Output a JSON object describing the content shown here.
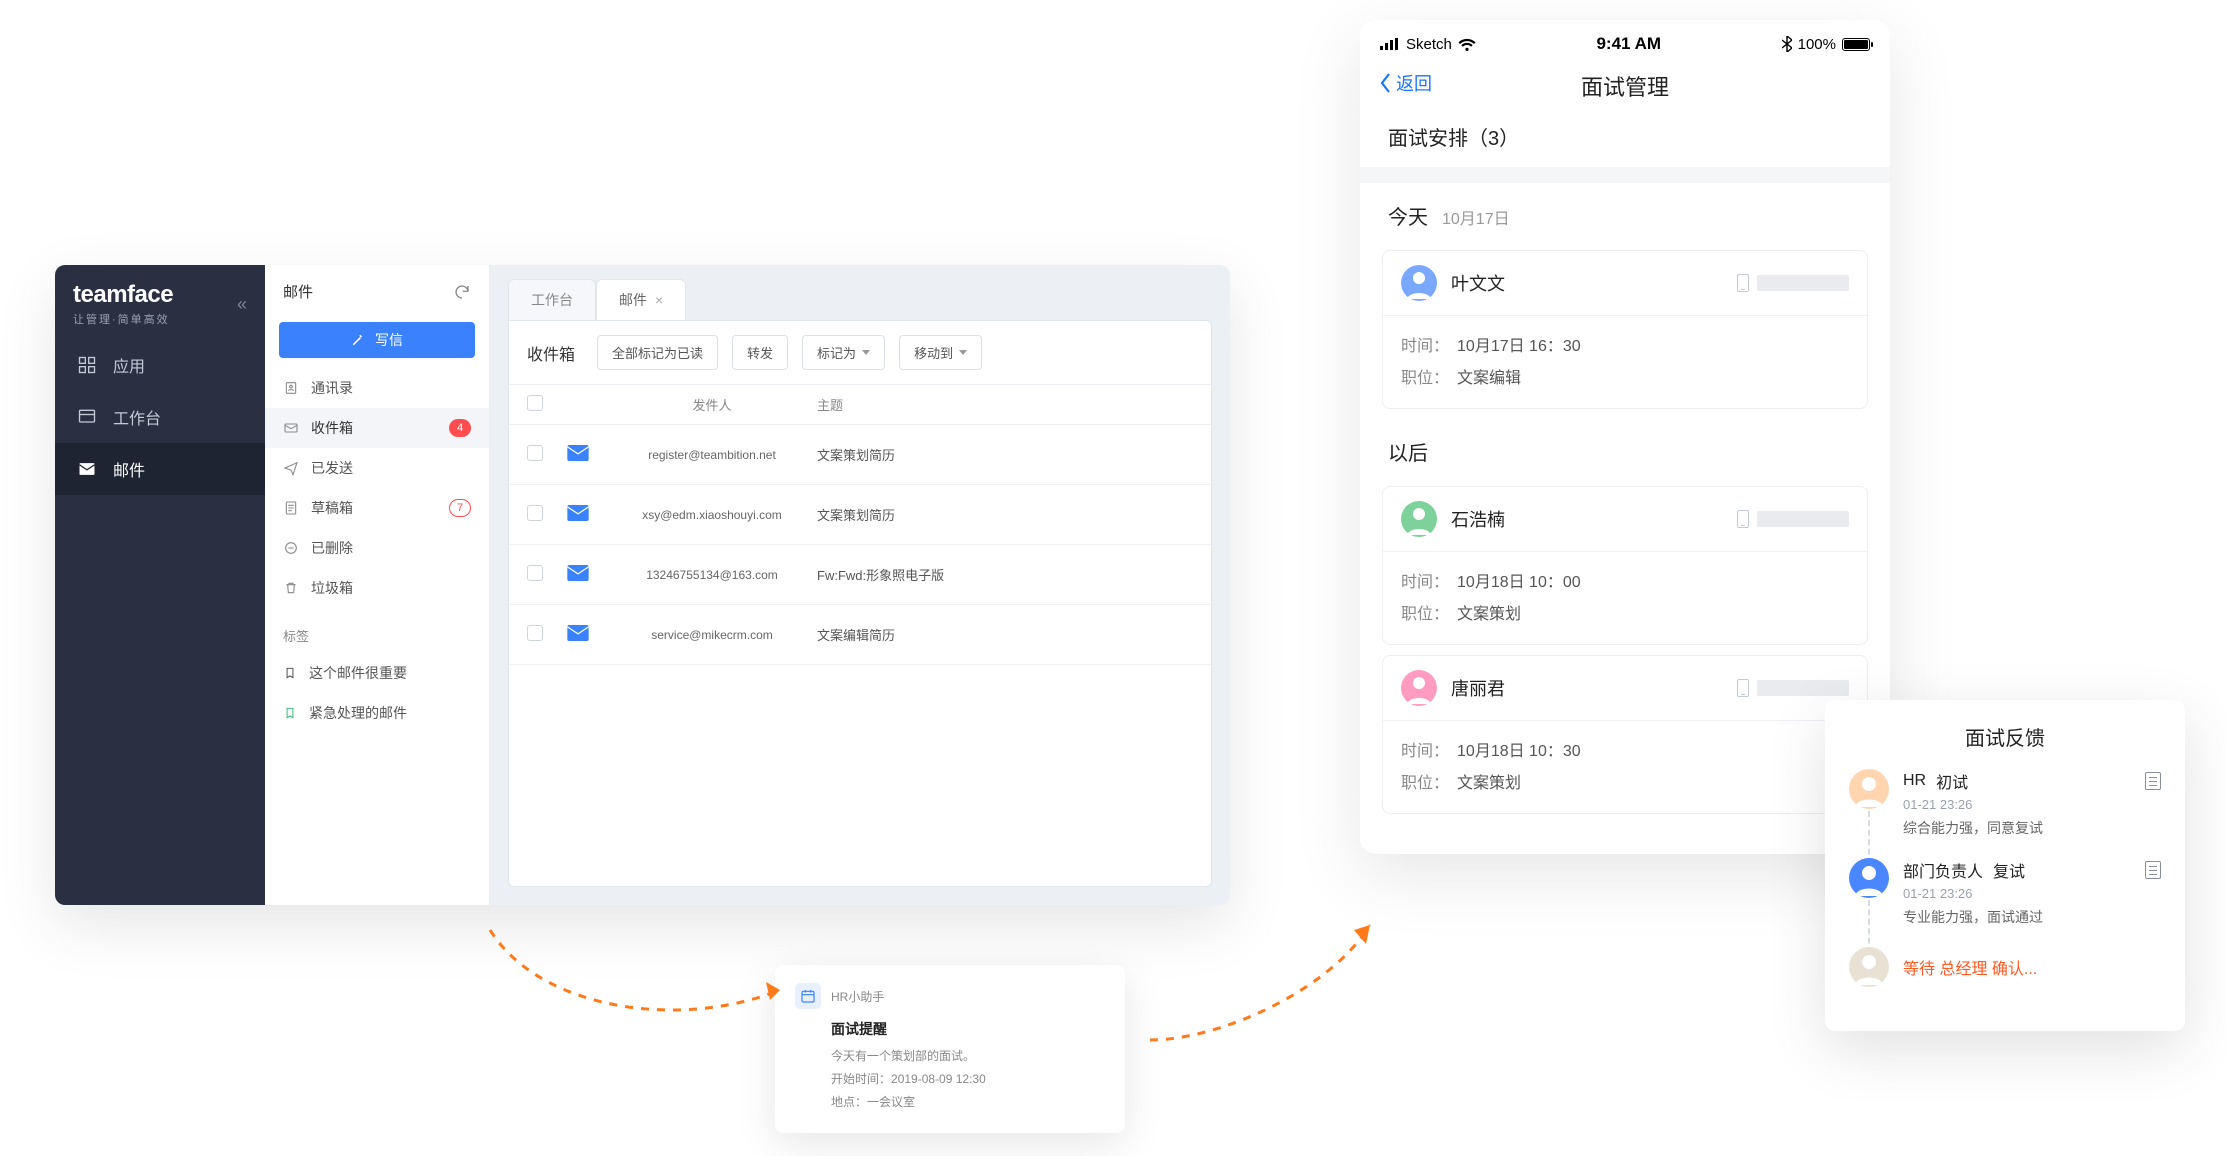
{
  "desktop": {
    "brand": "teamface",
    "brand_sub": "让管理·简单高效",
    "nav": [
      {
        "label": "应用"
      },
      {
        "label": "工作台"
      },
      {
        "label": "邮件"
      }
    ],
    "side_title": "邮件",
    "compose": "写信",
    "folders": [
      {
        "label": "通讯录"
      },
      {
        "label": "收件箱",
        "badge": "4",
        "badge_style": "red"
      },
      {
        "label": "已发送"
      },
      {
        "label": "草稿箱",
        "badge": "7",
        "badge_style": "outline"
      },
      {
        "label": "已删除"
      },
      {
        "label": "垃圾箱"
      }
    ],
    "tags_title": "标签",
    "tags": [
      {
        "label": "这个邮件很重要"
      },
      {
        "label": "紧急处理的邮件"
      }
    ],
    "tabs": [
      {
        "label": "工作台"
      },
      {
        "label": "邮件"
      }
    ],
    "toolbar": {
      "title": "收件箱",
      "mark_all_read": "全部标记为已读",
      "forward": "转发",
      "mark_as": "标记为",
      "move_to": "移动到"
    },
    "columns": {
      "from": "发件人",
      "subject": "主题"
    },
    "rows": [
      {
        "from": "register@teambition.net",
        "subject": "文案策划简历"
      },
      {
        "from": "xsy@edm.xiaoshouyi.com",
        "subject": "文案策划简历"
      },
      {
        "from": "13246755134@163.com",
        "subject": "Fw:Fwd:形象照电子版"
      },
      {
        "from": "service@mikecrm.com",
        "subject": "文案编辑简历"
      }
    ]
  },
  "notif": {
    "source": "HR小助手",
    "title": "面试提醒",
    "line1": "今天有一个策划部的面试。",
    "line2_k": "开始时间：",
    "line2_v": "2019-08-09 12:30",
    "line3_k": "地点：",
    "line3_v": "一会议室"
  },
  "phone": {
    "status": {
      "carrier": "Sketch",
      "time": "9:41 AM",
      "battery": "100%"
    },
    "back": "返回",
    "title": "面试管理",
    "sched_title": "面试安排（3）",
    "today_label": "今天",
    "today_date": "10月17日",
    "later_label": "以后",
    "kv": {
      "time": "时间：",
      "position": "职位："
    },
    "cards": [
      {
        "name": "叶文文",
        "time": "10月17日 16：30",
        "position": "文案编辑"
      },
      {
        "name": "石浩楠",
        "time": "10月18日 10：00",
        "position": "文案策划"
      },
      {
        "name": "唐丽君",
        "time": "10月18日 10：30",
        "position": "文案策划"
      }
    ]
  },
  "feedback": {
    "title": "面试反馈",
    "items": [
      {
        "role": "HR",
        "stage": "初试",
        "time": "01-21 23:26",
        "comment": "综合能力强，同意复试"
      },
      {
        "role": "部门负责人",
        "stage": "复试",
        "time": "01-21 23:26",
        "comment": "专业能力强，面试通过"
      }
    ],
    "waiting": "等待 总经理 确认..."
  }
}
